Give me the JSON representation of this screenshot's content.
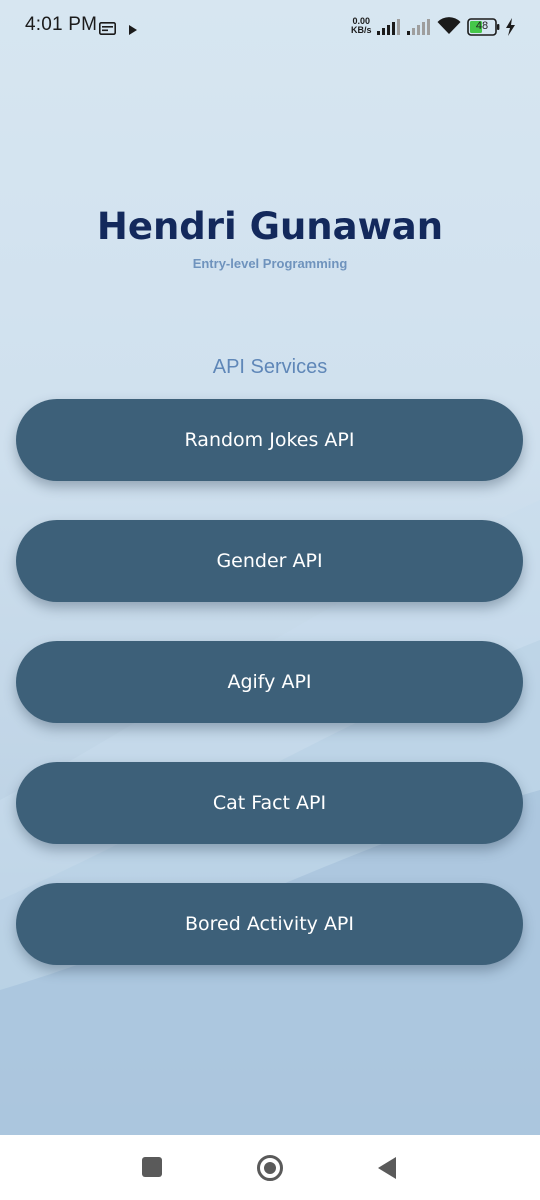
{
  "status_bar": {
    "time": "4:01 PM",
    "net_speed_value": "0.00",
    "net_speed_unit": "KB/s",
    "battery_level": "48",
    "icons": [
      "sim-card-icon",
      "play-icon",
      "signal-1-icon",
      "signal-2-icon",
      "wifi-icon",
      "battery-icon",
      "charging-icon"
    ]
  },
  "header": {
    "title": "Hendri Gunawan",
    "subtitle": "Entry-level Programming"
  },
  "section": {
    "label": "API Services"
  },
  "api_buttons": [
    {
      "label": "Random Jokes API"
    },
    {
      "label": "Gender API"
    },
    {
      "label": "Agify API"
    },
    {
      "label": "Cat Fact API"
    },
    {
      "label": "Bored Activity API"
    }
  ],
  "nav_bar": {
    "icons": [
      "recents-square-icon",
      "home-circle-icon",
      "back-triangle-icon"
    ]
  },
  "colors": {
    "title": "#13295c",
    "subtitle": "#6f93bd",
    "section_label": "#5f87b8",
    "button_bg": "#3d6079",
    "button_text": "#ffffff"
  }
}
